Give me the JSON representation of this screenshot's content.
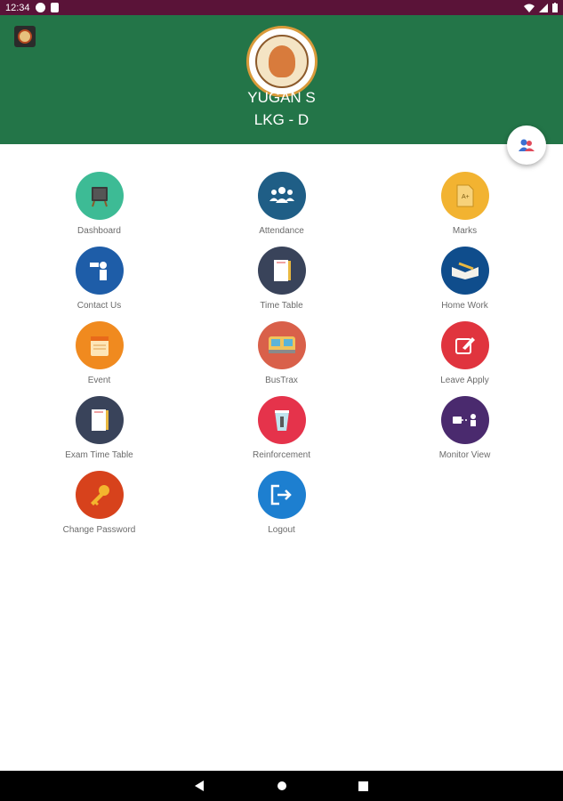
{
  "status_bar": {
    "time": "12:34"
  },
  "header": {
    "student_name": "YUGAN S",
    "student_class": "LKG - D",
    "bg_color": "#237548"
  },
  "menu": [
    {
      "label": "Dashboard",
      "icon": "dashboard-icon",
      "color": "#3dbb95"
    },
    {
      "label": "Attendance",
      "icon": "attendance-icon",
      "color": "#1f5e86"
    },
    {
      "label": "Marks",
      "icon": "marks-icon",
      "color": "#f2b331"
    },
    {
      "label": "Contact Us",
      "icon": "contact-icon",
      "color": "#1e5da8"
    },
    {
      "label": "Time Table",
      "icon": "timetable-icon",
      "color": "#39435a"
    },
    {
      "label": "Home Work",
      "icon": "homework-icon",
      "color": "#0f4d8c"
    },
    {
      "label": "Event",
      "icon": "event-icon",
      "color": "#f08a1f"
    },
    {
      "label": "BusTrax",
      "icon": "bus-icon",
      "color": "#d9604a"
    },
    {
      "label": "Leave Apply",
      "icon": "leave-icon",
      "color": "#e0343e"
    },
    {
      "label": "Exam Time Table",
      "icon": "exam-timetable-icon",
      "color": "#39435a"
    },
    {
      "label": "Reinforcement",
      "icon": "reinforcement-icon",
      "color": "#e5334b"
    },
    {
      "label": "Monitor View",
      "icon": "monitor-icon",
      "color": "#4a2a6e"
    },
    {
      "label": "Change Password",
      "icon": "key-icon",
      "color": "#d7421c"
    },
    {
      "label": "Logout",
      "icon": "logout-icon",
      "color": "#1d7fd0"
    }
  ]
}
